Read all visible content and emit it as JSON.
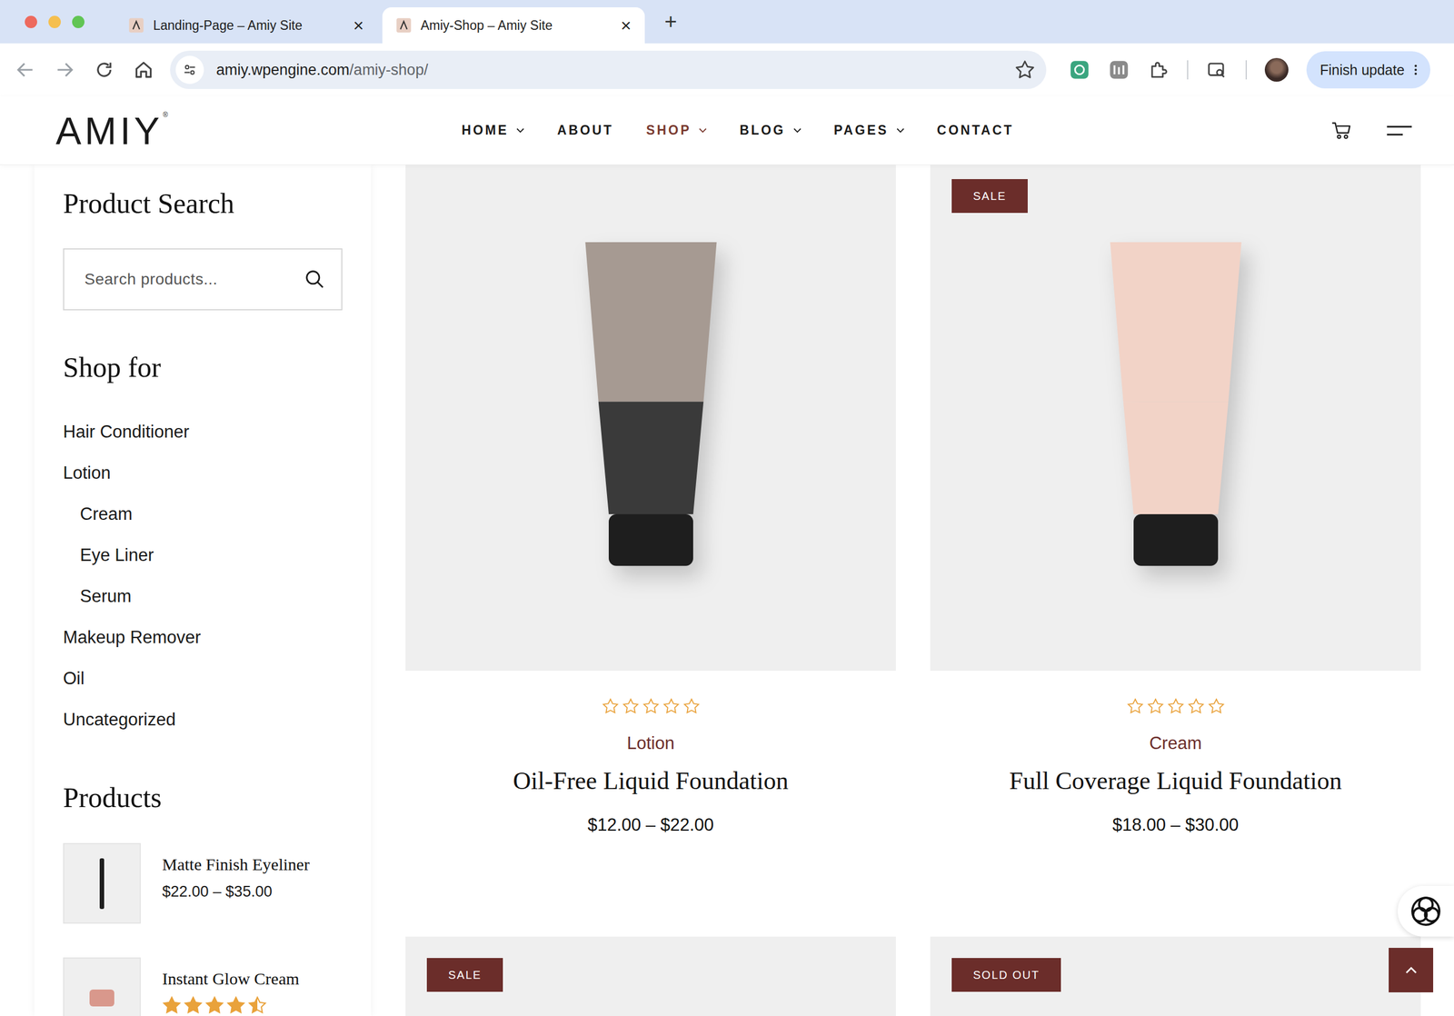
{
  "browser": {
    "tabs": [
      {
        "label": "Landing-Page – Amiy Site",
        "close": "×",
        "selected": false
      },
      {
        "label": "Amiy-Shop – Amiy Site",
        "close": "×",
        "selected": true
      }
    ],
    "new_tab": "+",
    "address": {
      "host": "amiy.wpengine.com",
      "path": "/amiy-shop/"
    },
    "update_button": "Finish update"
  },
  "site": {
    "logo": "AMIY",
    "logo_mark": "®",
    "nav": [
      {
        "label": "HOME",
        "dropdown": true,
        "selected": false
      },
      {
        "label": "ABOUT",
        "dropdown": false,
        "selected": false
      },
      {
        "label": "SHOP",
        "dropdown": true,
        "selected": true
      },
      {
        "label": "BLOG",
        "dropdown": true,
        "selected": false
      },
      {
        "label": "PAGES",
        "dropdown": true,
        "selected": false
      },
      {
        "label": "CONTACT",
        "dropdown": false,
        "selected": false
      }
    ]
  },
  "sidebar": {
    "search": {
      "title": "Product Search",
      "placeholder": "Search products..."
    },
    "categories": {
      "title": "Shop for",
      "items": [
        {
          "label": "Hair Conditioner",
          "child": false
        },
        {
          "label": "Lotion",
          "child": false
        },
        {
          "label": "Cream",
          "child": true
        },
        {
          "label": "Eye Liner",
          "child": true
        },
        {
          "label": "Serum",
          "child": true
        },
        {
          "label": "Makeup Remover",
          "child": false
        },
        {
          "label": "Oil",
          "child": false
        },
        {
          "label": "Uncategorized",
          "child": false
        }
      ]
    },
    "products": {
      "title": "Products",
      "items": [
        {
          "name": "Matte Finish Eyeliner",
          "price": "$22.00 – $35.00",
          "stars": null
        },
        {
          "name": "Instant Glow Cream",
          "price": null,
          "stars": 4.5
        }
      ]
    }
  },
  "products": [
    {
      "badge": null,
      "stars": 0,
      "category": "Lotion",
      "name": "Oil-Free Liquid Foundation",
      "price": "$12.00 – $22.00"
    },
    {
      "badge": "SALE",
      "stars": 0,
      "category": "Cream",
      "name": "Full Coverage Liquid Foundation",
      "price": "$18.00 – $30.00"
    },
    {
      "badge": "SALE",
      "stars": null,
      "category": null,
      "name": null,
      "price": null
    },
    {
      "badge": "SOLD OUT",
      "stars": null,
      "category": null,
      "name": null,
      "price": null
    }
  ]
}
